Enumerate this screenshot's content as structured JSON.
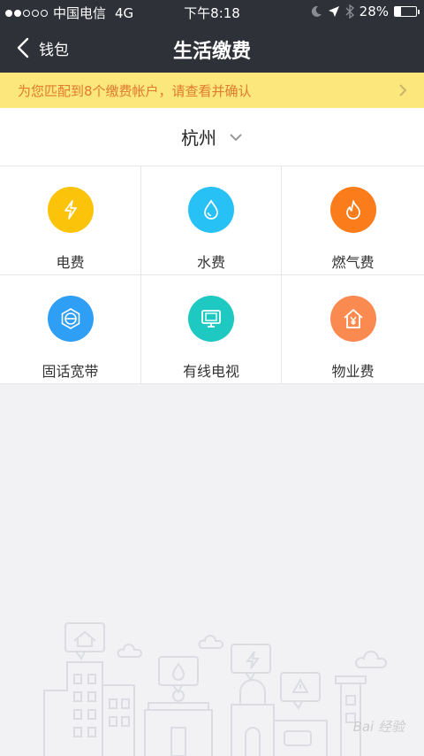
{
  "status_bar": {
    "carrier": "中国电信",
    "network": "4G",
    "time": "下午8:18",
    "battery": "28%",
    "battery_level": 0.28,
    "icons": [
      "moon-icon",
      "location-arrow-icon",
      "bluetooth-icon"
    ]
  },
  "nav": {
    "back_label": "钱包",
    "title": "生活缴费"
  },
  "notice": {
    "text": "为您匹配到8个缴费帐户，请查看并确认"
  },
  "city": {
    "name": "杭州"
  },
  "services": [
    {
      "label": "电费",
      "icon": "lightning-icon",
      "color": "#fcc30b"
    },
    {
      "label": "水费",
      "icon": "water-drop-icon",
      "color": "#27c1f5"
    },
    {
      "label": "燃气费",
      "icon": "flame-icon",
      "color": "#fb7c1b"
    },
    {
      "label": "固话宽带",
      "icon": "globe-icon",
      "color": "#2f9ff5"
    },
    {
      "label": "有线电视",
      "icon": "tv-icon",
      "color": "#1ec9c1"
    },
    {
      "label": "物业费",
      "icon": "house-yen-icon",
      "color": "#fb8a51"
    }
  ],
  "colors": {
    "nav_bg": "#2f3138",
    "notice_bg": "#fce77c",
    "notice_text": "#e07a2e",
    "page_bg": "#f2f2f4"
  },
  "watermark": "Bai 经验"
}
